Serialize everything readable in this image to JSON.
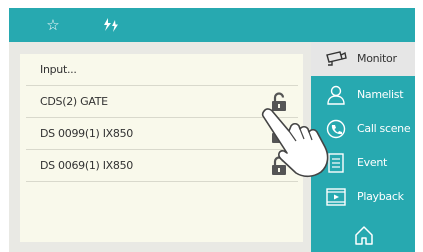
{
  "topbar": {
    "icons": [
      "star-icon",
      "flash-icon"
    ],
    "star_glyph": "☆"
  },
  "list": {
    "rows": [
      {
        "label": "Input...",
        "has_lock": false
      },
      {
        "label": "CDS(2) GATE",
        "has_lock": true
      },
      {
        "label": "DS 0099(1) IX850",
        "has_lock": true
      },
      {
        "label": "DS 0069(1) IX850",
        "has_lock": true
      }
    ]
  },
  "sidebar": {
    "items": [
      {
        "label": "Monitor",
        "icon": "camera-icon",
        "active": true
      },
      {
        "label": "Namelist",
        "icon": "person-icon",
        "active": false
      },
      {
        "label": "Call scene",
        "icon": "call-scene-icon",
        "active": false
      },
      {
        "label": "Event",
        "icon": "document-icon",
        "active": false
      },
      {
        "label": "Playback",
        "icon": "film-icon",
        "active": false
      }
    ],
    "home_icon": "home-icon"
  },
  "colors": {
    "accent": "#27a9b0",
    "list_bg": "#f9f9eb",
    "screen_bg": "#e9e9e4",
    "active_item_bg": "#e6e6e6"
  }
}
